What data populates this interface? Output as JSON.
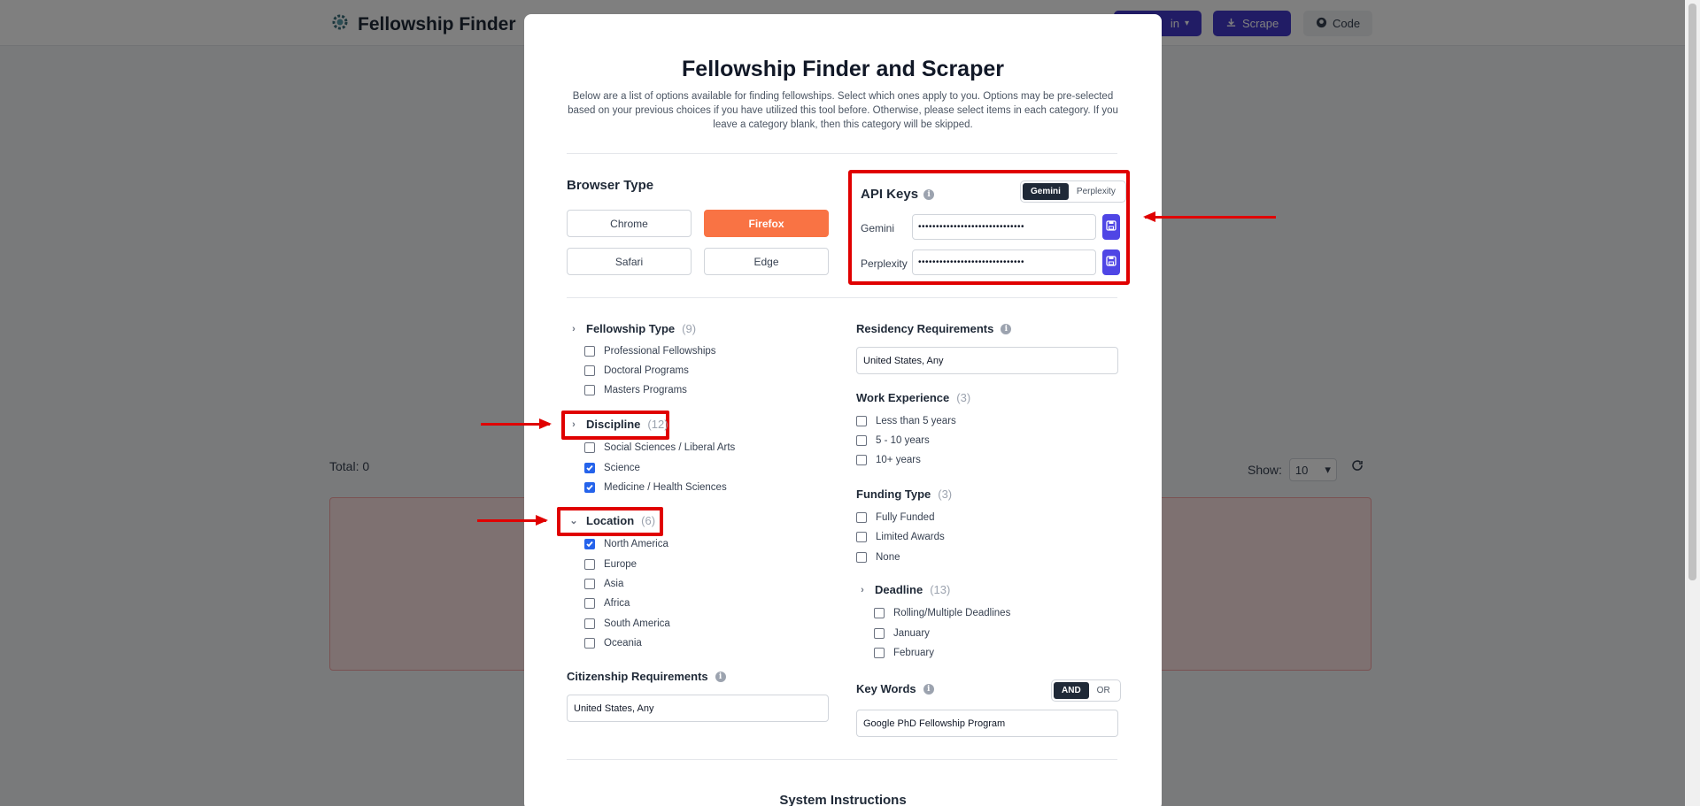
{
  "app": {
    "title": "Fellowship Finder",
    "header_buttons": {
      "partial_label": "in",
      "scrape": "Scrape",
      "code": "Code"
    },
    "total_label": "Total: 0",
    "show_label": "Show:",
    "show_value": "10"
  },
  "modal": {
    "title": "Fellowship Finder and Scraper",
    "description": "Below are a list of options available for finding fellowships. Select which ones apply to you. Options may be pre-selected based on your previous choices if you have utilized this tool before. Otherwise, please select items in each category. If you leave a category blank, then this category will be skipped.",
    "browser": {
      "title": "Browser Type",
      "options": [
        "Chrome",
        "Firefox",
        "Safari",
        "Edge"
      ],
      "selected": "Firefox"
    },
    "api_keys": {
      "title": "API Keys",
      "toggle": [
        "Gemini",
        "Perplexity"
      ],
      "toggle_selected": "Gemini",
      "gemini_label": "Gemini",
      "gemini_value": "••••••••••••••••••••••••••••••",
      "perplexity_label": "Perplexity",
      "perplexity_value": "••••••••••••••••••••••••••••••"
    },
    "fellowship_type": {
      "title": "Fellowship Type",
      "count": "(9)",
      "items": [
        {
          "label": "Professional Fellowships",
          "checked": false
        },
        {
          "label": "Doctoral Programs",
          "checked": false
        },
        {
          "label": "Masters Programs",
          "checked": false
        }
      ]
    },
    "discipline": {
      "title": "Discipline",
      "count": "(12)",
      "items": [
        {
          "label": "Social Sciences / Liberal Arts",
          "checked": false
        },
        {
          "label": "Science",
          "checked": true
        },
        {
          "label": "Medicine / Health Sciences",
          "checked": true
        }
      ]
    },
    "location": {
      "title": "Location",
      "count": "(6)",
      "items": [
        {
          "label": "North America",
          "checked": true
        },
        {
          "label": "Europe",
          "checked": false
        },
        {
          "label": "Asia",
          "checked": false
        },
        {
          "label": "Africa",
          "checked": false
        },
        {
          "label": "South America",
          "checked": false
        },
        {
          "label": "Oceania",
          "checked": false
        }
      ]
    },
    "citizenship": {
      "title": "Citizenship Requirements",
      "value": "United States, Any"
    },
    "residency": {
      "title": "Residency Requirements",
      "value": "United States, Any"
    },
    "work_experience": {
      "title": "Work Experience",
      "count": "(3)",
      "items": [
        {
          "label": "Less than 5 years",
          "checked": false
        },
        {
          "label": "5 - 10 years",
          "checked": false
        },
        {
          "label": "10+ years",
          "checked": false
        }
      ]
    },
    "funding_type": {
      "title": "Funding Type",
      "count": "(3)",
      "items": [
        {
          "label": "Fully Funded",
          "checked": false
        },
        {
          "label": "Limited Awards",
          "checked": false
        },
        {
          "label": "None",
          "checked": false
        }
      ]
    },
    "deadline": {
      "title": "Deadline",
      "count": "(13)",
      "items": [
        {
          "label": "Rolling/Multiple Deadlines",
          "checked": false
        },
        {
          "label": "January",
          "checked": false
        },
        {
          "label": "February",
          "checked": false
        }
      ]
    },
    "key_words": {
      "title": "Key Words",
      "toggle": [
        "AND",
        "OR"
      ],
      "toggle_selected": "AND",
      "value": "Google PhD Fellowship Program"
    },
    "system_instructions_title": "System Instructions"
  },
  "colors": {
    "accent": "#4f46e5",
    "browser_active": "#f97344",
    "checkbox_checked": "#2563eb",
    "annotation": "#e00000"
  }
}
